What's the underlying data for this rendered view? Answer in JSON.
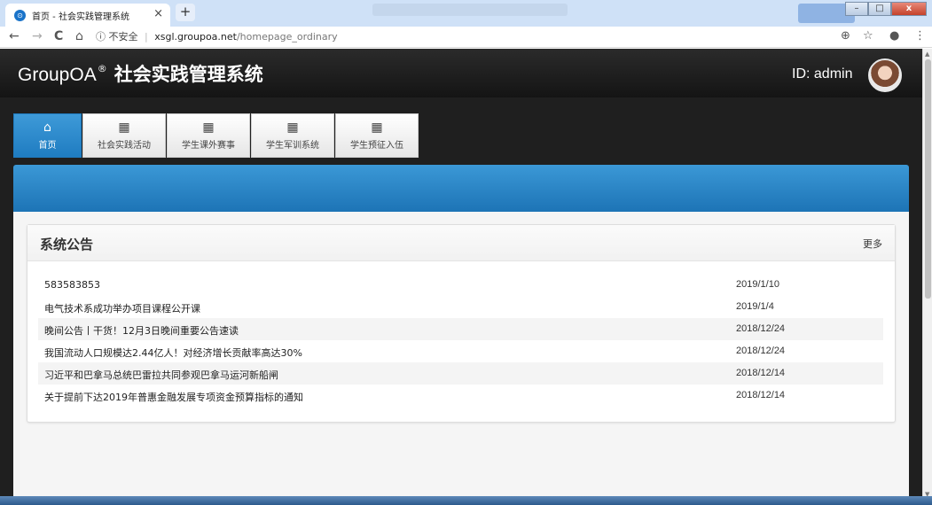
{
  "browser": {
    "tab_title": "首页 - 社会实践管理系统",
    "tab_close": "×",
    "new_tab": "+",
    "nav": {
      "back": "←",
      "forward": "→",
      "reload": "C",
      "home": "⌂"
    },
    "address": {
      "security_icon": "ⓘ",
      "security_text": "不安全",
      "separator": "|",
      "host": "xsgl.groupoa.net",
      "path": "/homepage_ordinary"
    },
    "right_icons": {
      "zoom": "⊕",
      "star": "☆",
      "account": "●",
      "menu": "⋮"
    }
  },
  "header": {
    "brand": "GroupOA",
    "registered_mark": "®",
    "title": "社会实践管理系统",
    "user_label": "ID: admin"
  },
  "nav_tabs": [
    {
      "label": "首页",
      "icon": "home-icon",
      "icon_glyph": "⌂",
      "active": true
    },
    {
      "label": "社会实践活动",
      "icon": "grid-icon",
      "icon_glyph": "▦",
      "active": false
    },
    {
      "label": "学生课外赛事",
      "icon": "grid-icon",
      "icon_glyph": "▦",
      "active": false
    },
    {
      "label": "学生军训系统",
      "icon": "grid-icon",
      "icon_glyph": "▦",
      "active": false
    },
    {
      "label": "学生预征入伍",
      "icon": "grid-icon",
      "icon_glyph": "▦",
      "active": false
    }
  ],
  "notice": {
    "title": "系统公告",
    "more_label": "更多",
    "items": [
      {
        "title": "583583853",
        "date": "2019/1/10"
      },
      {
        "title": "电气技术系成功举办项目课程公开课",
        "date": "2019/1/4"
      },
      {
        "title": "晚间公告丨干货！12月3日晚间重要公告速读",
        "date": "2018/12/24"
      },
      {
        "title": "我国流动人口规模达2.44亿人！对经济增长贡献率高达30%",
        "date": "2018/12/24"
      },
      {
        "title": "习近平和巴拿马总统巴雷拉共同参观巴拿马运河新船闸",
        "date": "2018/12/14"
      },
      {
        "title": "关于提前下达2019年普惠金融发展专项资金预算指标的通知",
        "date": "2018/12/14"
      }
    ]
  },
  "colors": {
    "header_bg": "#1f1f1f",
    "accent_blue": "#2a8ad0",
    "active_tab": "#2a8ad0"
  }
}
